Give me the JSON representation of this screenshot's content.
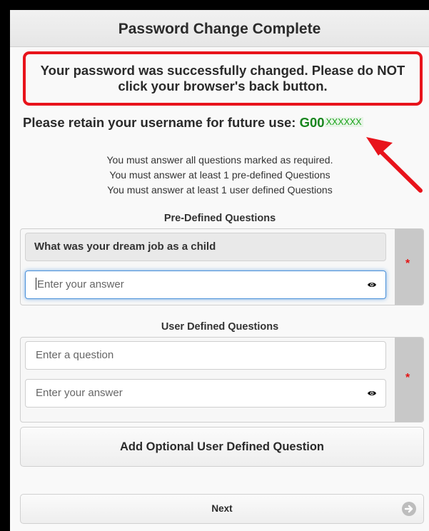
{
  "header": {
    "title": "Password Change Complete"
  },
  "alert": {
    "message": "Your password was successfully changed. Please do NOT click your browser's back button."
  },
  "retain": {
    "label": "Please retain your username for future use:",
    "username_prefix": "G00",
    "username_masked": "XXXXXX"
  },
  "instructions": [
    "You must answer all questions marked as required.",
    "You must answer at least 1 pre-defined Questions",
    "You must answer at least 1 user defined Questions"
  ],
  "predefined": {
    "title": "Pre-Defined Questions",
    "question": "What was your dream job as a child",
    "answer_placeholder": "Enter your answer",
    "required_marker": "*"
  },
  "userdefined": {
    "title": "User Defined Questions",
    "question_placeholder": "Enter a question",
    "answer_placeholder": "Enter your answer",
    "required_marker": "*"
  },
  "buttons": {
    "add_optional": "Add Optional User Defined Question",
    "next": "Next"
  },
  "colors": {
    "alert_border": "#e8131b",
    "username": "#19861f",
    "required": "#e31414",
    "focus": "#4a90d9"
  }
}
